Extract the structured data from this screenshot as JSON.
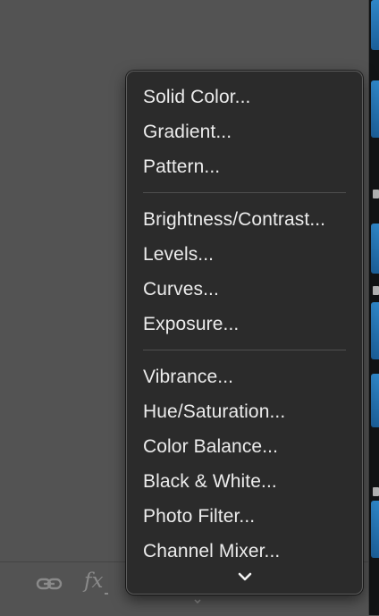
{
  "menu": {
    "groups": [
      {
        "items": [
          {
            "label": "Solid Color..."
          },
          {
            "label": "Gradient..."
          },
          {
            "label": "Pattern..."
          }
        ]
      },
      {
        "items": [
          {
            "label": "Brightness/Contrast..."
          },
          {
            "label": "Levels..."
          },
          {
            "label": "Curves..."
          },
          {
            "label": "Exposure..."
          }
        ]
      },
      {
        "items": [
          {
            "label": "Vibrance..."
          },
          {
            "label": "Hue/Saturation..."
          },
          {
            "label": "Color Balance..."
          },
          {
            "label": "Black & White..."
          },
          {
            "label": "Photo Filter..."
          },
          {
            "label": "Channel Mixer..."
          }
        ]
      }
    ],
    "scroll_indicator_icon": "chevron-down-icon"
  },
  "footer": {
    "icons": [
      "link-icon",
      "fx-icon"
    ],
    "fx_label": "fx"
  },
  "colors": {
    "panel_bg": "#535353",
    "menu_bg": "#2b2b2b",
    "menu_text": "#ececec",
    "separator": "#4f4f4f",
    "footer_icon": "#8a8a8a",
    "strip_accent": "#2f86c8"
  }
}
